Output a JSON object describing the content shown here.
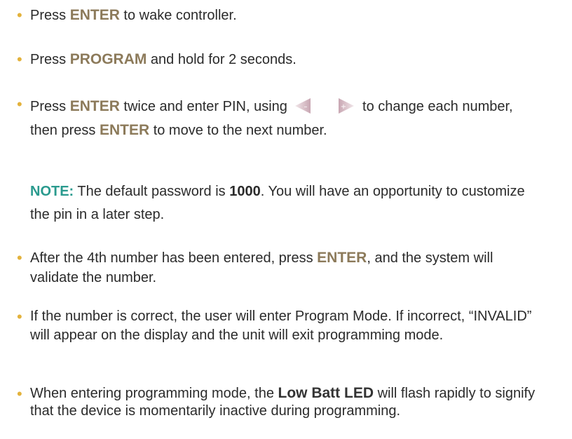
{
  "colors": {
    "bullet": "#e3b23c",
    "keyword": "#8c7a5a",
    "note": "#2a9a8e"
  },
  "items": [
    {
      "pre": "Press ",
      "kw": "ENTER",
      "post": " to wake controller."
    },
    {
      "pre": "Press ",
      "kw": "PROGRAM",
      "post": " and hold for 2 seconds."
    },
    {
      "pre": "Press ",
      "kw": "ENTER",
      "mid": " twice and enter PIN, using ",
      "minus_glyph": "–",
      "plus_glyph": "+",
      "post1": " to change each number, then press ",
      "kw2": "ENTER",
      "post2": " to move to the next number."
    }
  ],
  "note": {
    "label": "NOTE:",
    "text1": " The default password is ",
    "pin": "1000",
    "text2": ". You will have an opportunity to customize the pin in a later step."
  },
  "items2": [
    {
      "pre": "After the 4th number has been entered, press ",
      "kw": "ENTER",
      "post": ", and the system will validate the number."
    },
    {
      "text": "If the number is correct, the user will enter  Program Mode.  If incorrect, “INVALID” will appear on the display and the unit will exit programming mode."
    },
    {
      "pre": "When entering programming mode, the ",
      "kw": "Low Batt LED",
      "post": " will flash rapidly to signify that the device is momentarily inactive during programming."
    }
  ],
  "icons": [
    "left-arrow-minus-icon",
    "right-arrow-plus-icon"
  ]
}
